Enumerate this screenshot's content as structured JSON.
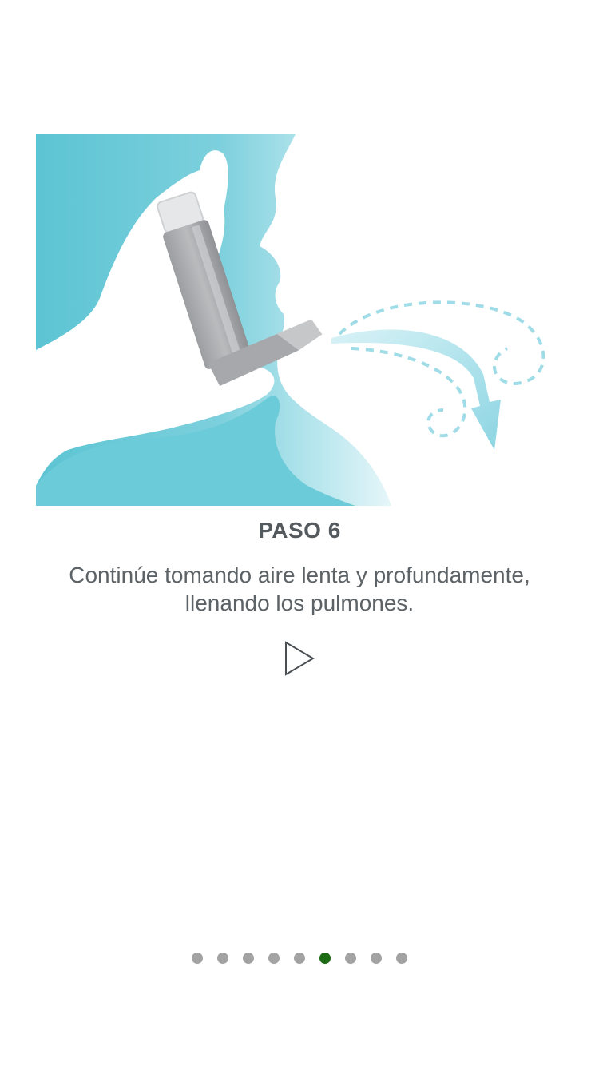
{
  "step": {
    "title": "PASO 6",
    "description": "Continúe tomando aire lenta y profundamente, llenando los pulmones."
  },
  "illustration": {
    "subject": "person-inhaling-from-inhaler",
    "colors": {
      "background_left": "#5cc4d3",
      "background_right": "#c9eef3",
      "inhaler_body": "#a9abad",
      "inhaler_cap": "#e6e7e8",
      "airflow": "#8fd6e3"
    }
  },
  "controls": {
    "play_icon": "play-triangle-icon"
  },
  "pager": {
    "total": 9,
    "current": 6,
    "active_color": "#1d6b14",
    "inactive_color": "#a3a3a3"
  }
}
